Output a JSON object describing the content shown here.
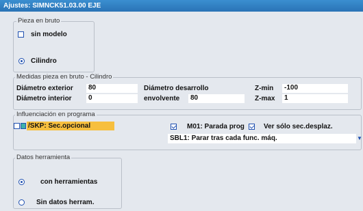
{
  "window": {
    "title": "Ajustes:  SIMNCK51.03.00   EJE"
  },
  "stock": {
    "legend": "Pieza en bruto",
    "options": [
      {
        "label": "sin modelo",
        "control": "checkbox",
        "checked": false
      },
      {
        "label": "Cilindro",
        "control": "radio",
        "selected": true
      }
    ]
  },
  "dimensions": {
    "legend": "Medidas pieza en bruto - Cilindro",
    "diam_ext_label": "Diámetro exterior",
    "diam_ext_value": "80",
    "diam_int_label": "Diámetro interior",
    "diam_int_value": "0",
    "diam_des_label": "Diámetro desarrollo",
    "envolvente_label": "envolvente",
    "envolvente_value": "80",
    "zmin_label": "Z-min",
    "zmin_value": "-100",
    "zmax_label": "Z-max",
    "zmax_value": "1"
  },
  "program": {
    "legend": "Influenciación en programa",
    "skp_label": "/SKP: Sec.opcional",
    "m01_label": "M01: Parada prog",
    "m01_checked": true,
    "ver_label": "Ver sólo sec.desplaz.",
    "ver_checked": true,
    "sbl_value": "SBL1: Parar tras cada func. máq.",
    "dropdown_icon": "chevron-down-icon"
  },
  "tools": {
    "legend": "Datos herramienta",
    "options": [
      {
        "label": "con herramientas",
        "selected": true
      },
      {
        "label": "Sin datos herram.",
        "selected": false
      }
    ]
  },
  "colors": {
    "title_bar": "#2a73b6",
    "accent": "#1e4fb0",
    "highlight": "#f7bf3e",
    "panel": "#e4e8ee"
  }
}
